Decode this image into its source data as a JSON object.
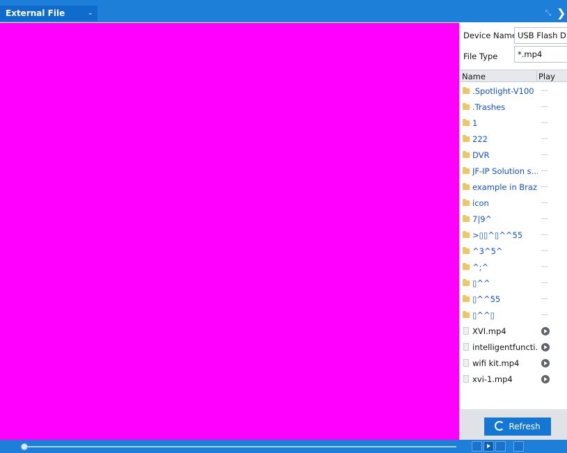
{
  "header": {
    "mode_label": "External File"
  },
  "panel": {
    "device_name_label": "Device Name",
    "device_name_value": "USB Flash Di",
    "file_type_label": "File Type",
    "file_type_value": "*.mp4",
    "col_name": "Name",
    "col_play": "Play",
    "items": [
      {
        "name": ".Spotlight-V100",
        "type": "folder"
      },
      {
        "name": ".Trashes",
        "type": "folder"
      },
      {
        "name": "1",
        "type": "folder"
      },
      {
        "name": "222",
        "type": "folder"
      },
      {
        "name": "DVR",
        "type": "folder"
      },
      {
        "name": "JF-IP Solution s...",
        "type": "folder"
      },
      {
        "name": "example in Brazil",
        "type": "folder"
      },
      {
        "name": "icon",
        "type": "folder"
      },
      {
        "name": "7|9^",
        "type": "folder"
      },
      {
        "name": ">▯▯^▯^^55",
        "type": "folder"
      },
      {
        "name": "^3^5^",
        "type": "folder"
      },
      {
        "name": "^;^",
        "type": "folder"
      },
      {
        "name": "▯^^",
        "type": "folder"
      },
      {
        "name": "▯^^55",
        "type": "folder"
      },
      {
        "name": "▯^^▯",
        "type": "folder"
      },
      {
        "name": "XVI.mp4",
        "type": "file"
      },
      {
        "name": "intelligentfuncti...",
        "type": "file"
      },
      {
        "name": "wifi kit.mp4",
        "type": "file"
      },
      {
        "name": "xvi-1.mp4",
        "type": "file"
      }
    ],
    "dash": "—",
    "refresh_label": "Refresh"
  },
  "playback": {
    "progress": 0
  },
  "colors": {
    "bar_blue": "#1e7fd8",
    "video_bg": "#ff00ff",
    "folder_text": "#1050e0"
  }
}
